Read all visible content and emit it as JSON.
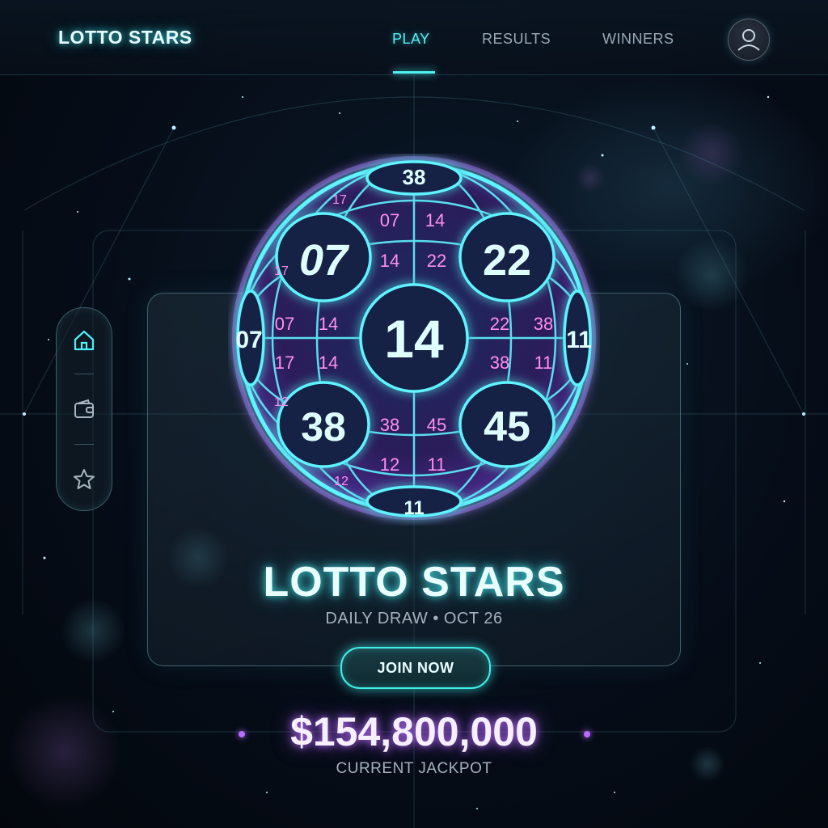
{
  "header": {
    "brand": "LOTTO STARS",
    "nav": [
      {
        "label": "PLAY",
        "active": true
      },
      {
        "label": "RESULTS",
        "active": false
      },
      {
        "label": "WINNERS",
        "active": false
      }
    ],
    "avatar_icon": "user-icon"
  },
  "side_rail": {
    "items": [
      {
        "icon": "home-icon",
        "active": true
      },
      {
        "icon": "wallet-icon",
        "active": false
      },
      {
        "icon": "star-icon",
        "active": false
      }
    ]
  },
  "orb": {
    "center_number": "14",
    "large_numbers": [
      "07",
      "22",
      "38",
      "45"
    ],
    "top_number": "38",
    "bottom_number": "11",
    "left_number": "07",
    "right_number": "11",
    "small_numbers": [
      "07",
      "14",
      "14",
      "22",
      "07",
      "14",
      "22",
      "38",
      "17",
      "14",
      "38",
      "11",
      "38",
      "45",
      "12",
      "11",
      "17",
      "17",
      "12",
      "12"
    ]
  },
  "main": {
    "title": "LOTTO STARS",
    "subtitle": "DAILY DRAW  •  OCT 26",
    "cta_label": "JOIN NOW",
    "jackpot_amount": "$154,800,000",
    "jackpot_label": "CURRENT JACKPOT"
  },
  "colors": {
    "accent_cyan": "#4ef0f5",
    "accent_purple": "#b76cff",
    "background": "#060d18"
  }
}
